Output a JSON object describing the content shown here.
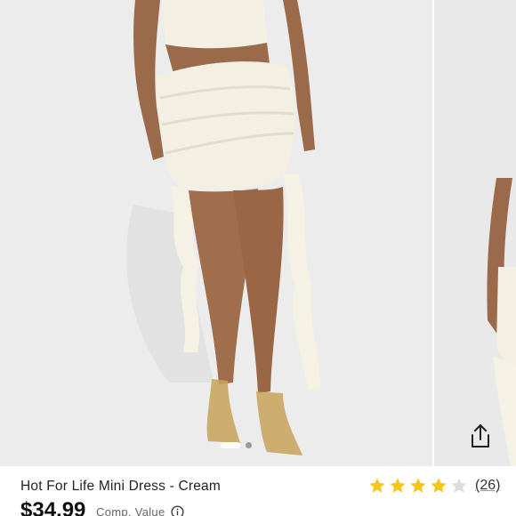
{
  "product": {
    "title": "Hot For Life Mini Dress - Cream",
    "price": "$34.99",
    "comp_value_label": "Comp. Value",
    "rating": 4,
    "rating_max": 5,
    "review_count": "(26)"
  },
  "gallery": {
    "slide_count": 2,
    "active_slide": 1
  },
  "icons": {
    "share": "share-icon",
    "info": "info-icon",
    "star": "star-icon"
  },
  "colors": {
    "star_filled": "#f5c518",
    "star_empty": "#dddddd",
    "text_primary": "#222222"
  }
}
